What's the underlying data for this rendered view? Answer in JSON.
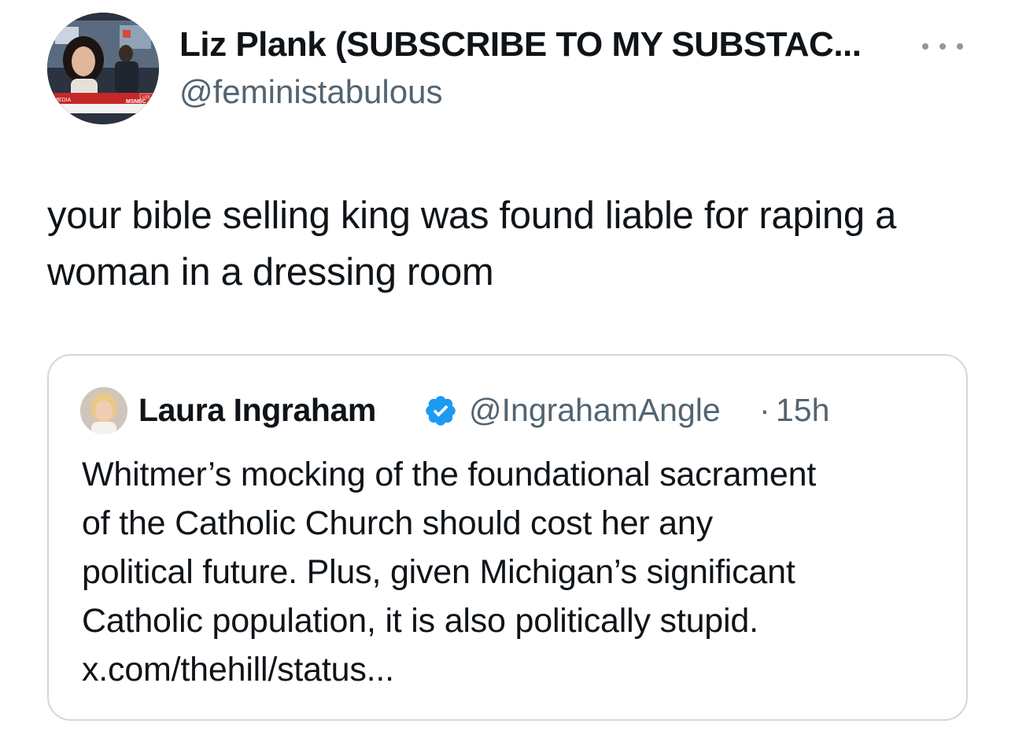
{
  "author": {
    "display_name": "Liz Plank (SUBSCRIBE TO MY SUBSTAC...",
    "handle": "@feministabulous",
    "avatar_overlay": {
      "network": "MSNBC",
      "live": "LIVE",
      "label": "MEDIA"
    }
  },
  "tweet": {
    "text": "your bible selling king was found liable for raping a woman in a dressing room"
  },
  "quoted_tweet": {
    "display_name": "Laura Ingraham",
    "handle": "@IngrahamAngle",
    "separator": "·",
    "time": "15h",
    "verified_icon": "verified-badge-icon",
    "lines": [
      "Whitmer’s mocking of the foundational sacrament",
      "of the Catholic Church should cost her any",
      "political future.  Plus, given Michigan’s significant",
      "Catholic population, it is also politically stupid.",
      "x.com/thehill/status..."
    ]
  },
  "colors": {
    "text_primary": "#0f1419",
    "text_secondary": "#536471",
    "border": "#cfd9de",
    "verified_blue": "#1d9bf0"
  }
}
